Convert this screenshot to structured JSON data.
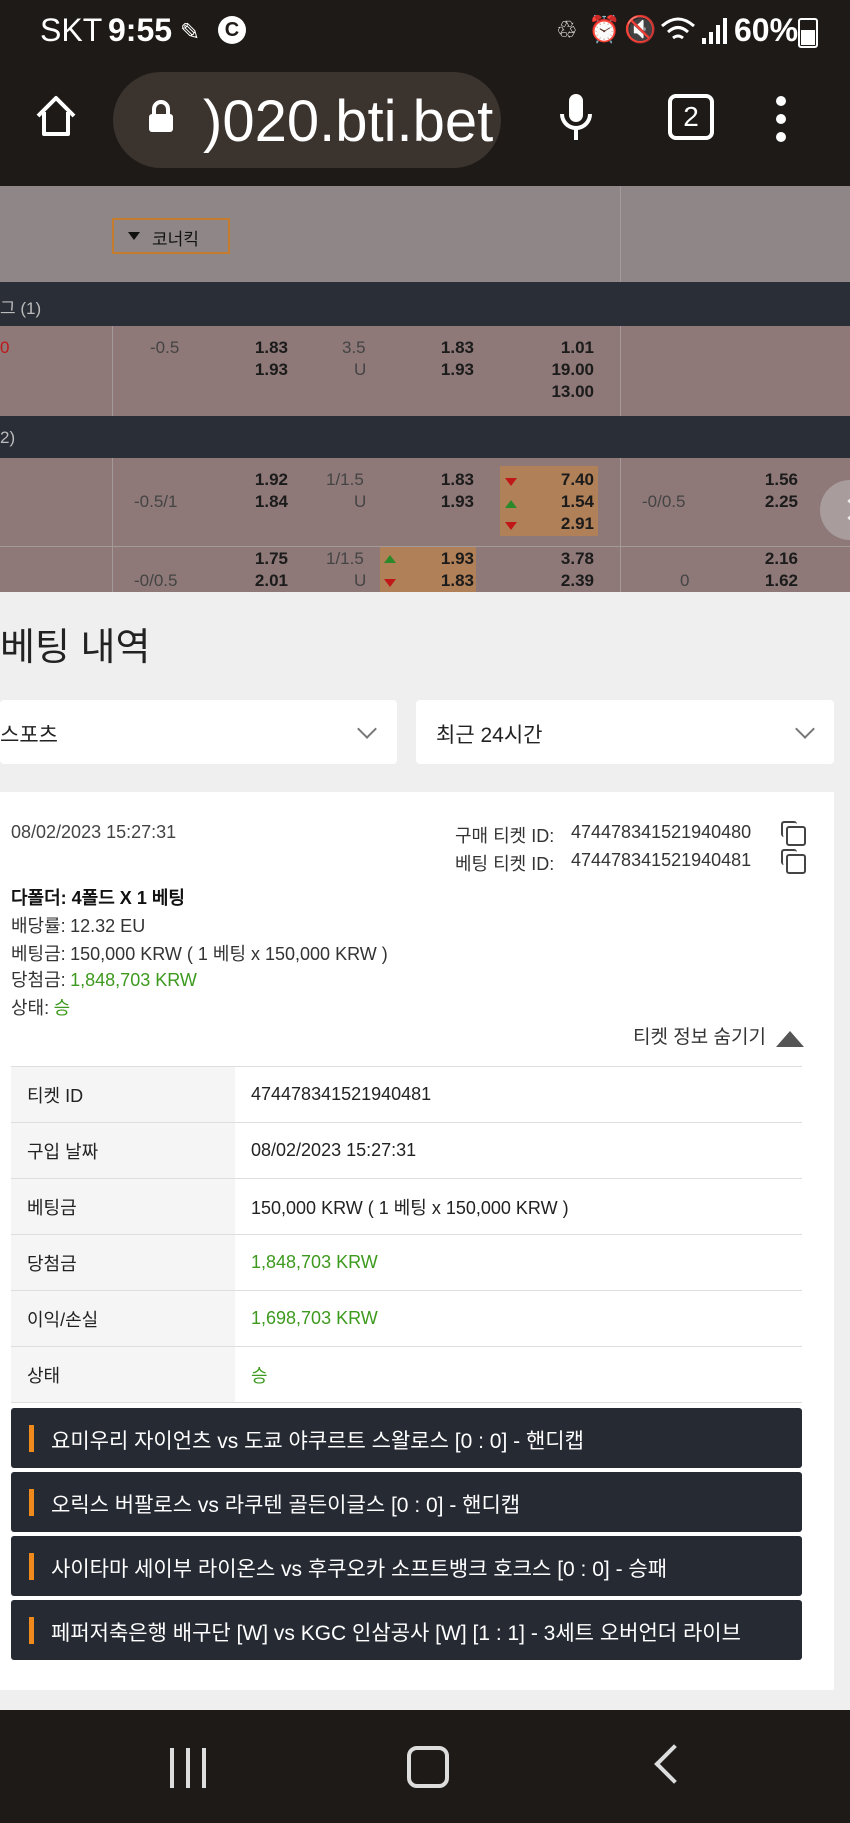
{
  "status_bar": {
    "carrier": "SKT",
    "time": "9:55",
    "battery": "60%"
  },
  "browser": {
    "url": ")020.bti.bet",
    "tab_count": "2"
  },
  "odds": {
    "corner_label": "코너킥",
    "league1_header": "그 (1)",
    "league2_header": "2)",
    "row1": {
      "handicap": "-0.5",
      "h_odds": [
        "1.83",
        "1.93"
      ],
      "total": "3.5",
      "total_u": "U",
      "t_odds": [
        "1.83",
        "1.93"
      ],
      "m_odds": [
        "1.01",
        "19.00",
        "13.00"
      ]
    },
    "row2": {
      "handicap": "-0.5/1",
      "h_odds": [
        "1.92",
        "1.84"
      ],
      "total": "1/1.5",
      "total_u": "U",
      "t_odds": [
        "1.83",
        "1.93"
      ],
      "m_odds": [
        "7.40",
        "1.54",
        "2.91"
      ],
      "h2": "-0/0.5",
      "h2_odds": [
        "1.56",
        "2.25"
      ]
    },
    "row3": {
      "handicap": "-0/0.5",
      "h_odds": [
        "1.75",
        "2.01"
      ],
      "total": "1/1.5",
      "total_u": "U",
      "t_odds": [
        "1.93",
        "1.83"
      ],
      "m_odds": [
        "3.78",
        "2.39"
      ],
      "h2": "0",
      "h2_odds": [
        "2.16",
        "1.62"
      ]
    }
  },
  "panel": {
    "title": "베팅 내역",
    "sport_select": "스포츠",
    "time_select": "최근 24시간"
  },
  "ticket": {
    "date": "08/02/2023 15:27:31",
    "purchase_id_label": "구매 티켓 ID:",
    "purchase_id": "474478341521940480",
    "bet_id_label": "베팅 티켓 ID:",
    "bet_id": "474478341521940481",
    "bet_type": "다폴더: 4폴드 X 1 베팅",
    "odds_label": "배당률:",
    "odds_value": "12.32 EU",
    "stake_label": "베팅금:",
    "stake_value": "150,000 KRW ( 1 베팅 x 150,000 KRW )",
    "win_label": "당첨금:",
    "win_value": "1,848,703 KRW",
    "status_label": "상태:",
    "status_value": "승",
    "hide_info": "티켓 정보 숨기기",
    "table": [
      {
        "key": "티켓 ID",
        "value": "474478341521940481"
      },
      {
        "key": "구입 날짜",
        "value": "08/02/2023 15:27:31"
      },
      {
        "key": "베팅금",
        "value": "150,000 KRW ( 1 베팅 x 150,000 KRW )"
      },
      {
        "key": "당첨금",
        "value": "1,848,703 KRW"
      },
      {
        "key": "이익/손실",
        "value": "1,698,703 KRW"
      },
      {
        "key": "상태",
        "value": "승"
      }
    ],
    "events": [
      "요미우리 자이언츠 vs 도쿄 야쿠르트 스왈로스 [0 : 0] - 핸디캡",
      "오릭스 버팔로스 vs 라쿠텐 골든이글스 [0 : 0] - 핸디캡",
      "사이타마 세이부 라이온스 vs 후쿠오카 소프트뱅크 호크스 [0 : 0] - 승패",
      "페퍼저축은행 배구단 [W] vs KGC 인삼공사 [W] [1 : 1] - 3세트 오버언더 라이브"
    ]
  }
}
